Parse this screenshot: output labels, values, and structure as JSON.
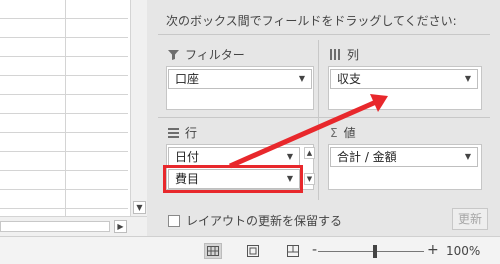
{
  "pane": {
    "instruction": "次のボックス間でフィールドをドラッグしてください:",
    "filter_label": "フィルター",
    "columns_label": "列",
    "rows_label": "行",
    "values_label": "値",
    "filter_fields": [
      "口座"
    ],
    "column_fields": [
      "収支"
    ],
    "row_fields": [
      "日付",
      "費目"
    ],
    "value_fields": [
      "合計 / 金額"
    ],
    "defer_update_label": "レイアウトの更新を保留する",
    "update_button": "更新"
  },
  "status": {
    "zoom": "100%",
    "zoom_minus": "-",
    "zoom_plus": "+"
  },
  "colors": {
    "highlight": "#e8282c",
    "arrow": "#e8282c"
  },
  "icons": {
    "filter": "funnel-icon",
    "columns": "columns-icon",
    "rows": "rows-icon",
    "values": "sigma-icon"
  }
}
